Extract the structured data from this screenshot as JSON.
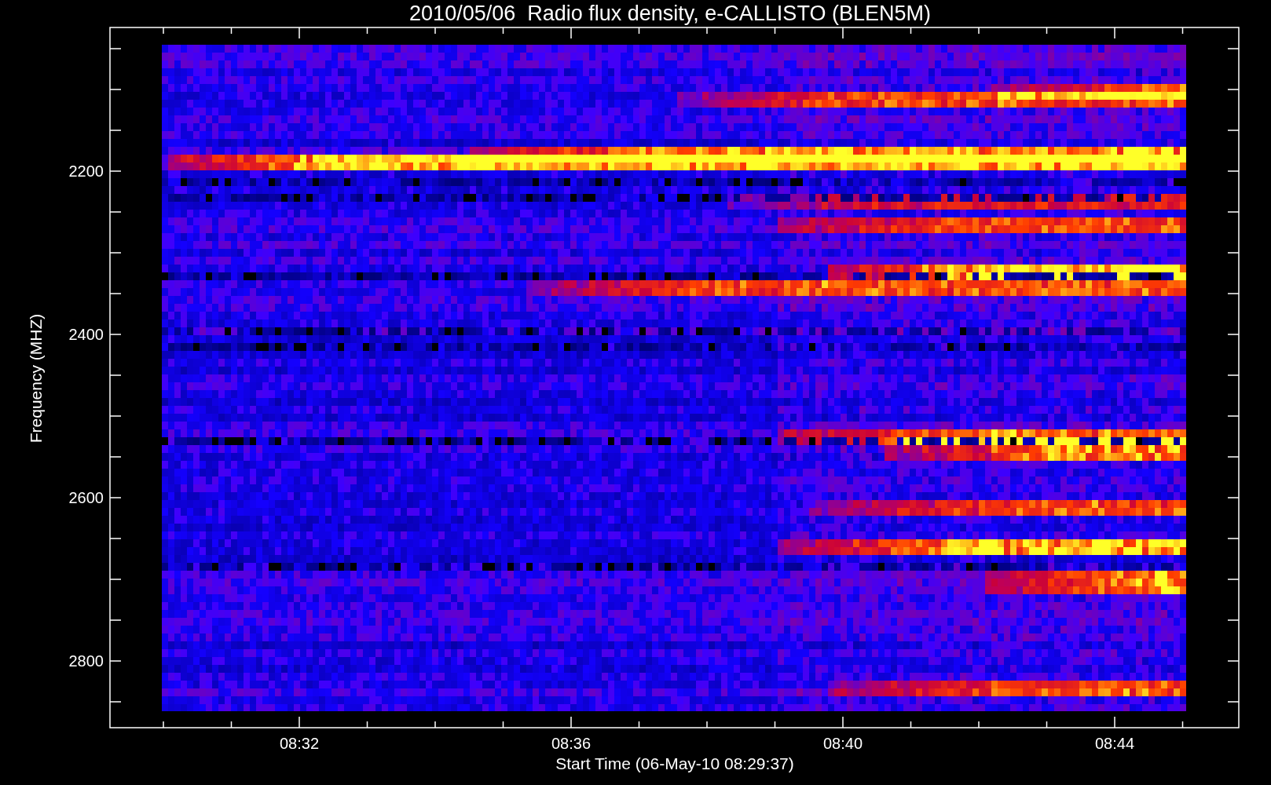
{
  "plot": {
    "title": "2010/05/06  Radio flux density, e-CALLISTO (BLEN5M)",
    "y_axis": {
      "label": "Frequency (MHZ)",
      "ticks": [
        "2200",
        "2400",
        "2600",
        "2800"
      ]
    },
    "x_axis": {
      "label": "Start Time (06-May-10 08:29:37)",
      "ticks": [
        "08:32",
        "08:36",
        "08:40",
        "08:44"
      ]
    }
  }
}
